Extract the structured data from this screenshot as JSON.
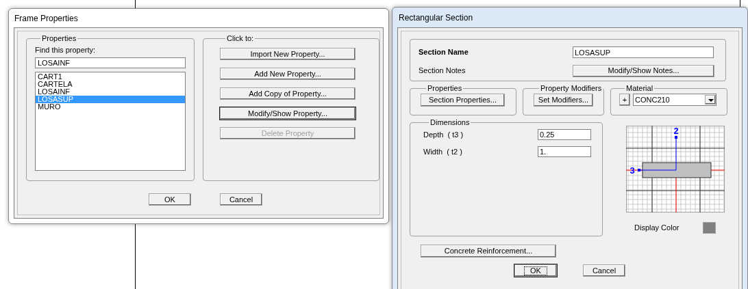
{
  "frame_properties": {
    "title": "Frame Properties",
    "properties_group": {
      "label": "Properties",
      "find_label": "Find this property:",
      "find_value": "LOSAINF",
      "items": [
        {
          "label": "CART1",
          "selected": false
        },
        {
          "label": "CARTELA",
          "selected": false
        },
        {
          "label": "LOSAINF",
          "selected": false
        },
        {
          "label": "LOSASUP",
          "selected": true
        },
        {
          "label": "MURO",
          "selected": false
        }
      ]
    },
    "click_to_group": {
      "label": "Click to:",
      "buttons": [
        {
          "label": "Import New Property...",
          "disabled": false,
          "focused": false
        },
        {
          "label": "Add New Property...",
          "disabled": false,
          "focused": false
        },
        {
          "label": "Add Copy of Property...",
          "disabled": false,
          "focused": false
        },
        {
          "label": "Modify/Show Property...",
          "disabled": false,
          "focused": true
        },
        {
          "label": "Delete Property",
          "disabled": true,
          "focused": false
        }
      ]
    },
    "buttons": [
      {
        "label": "OK",
        "focused": false
      },
      {
        "label": "Cancel",
        "focused": false
      }
    ]
  },
  "rectangular_section": {
    "title": "Rectangular Section",
    "section_name_label": "Section Name",
    "section_name_value": "LOSASUP",
    "section_notes_label": "Section Notes",
    "notes_button": "Modify/Show Notes...",
    "properties": {
      "label": "Properties",
      "button": "Section Properties..."
    },
    "property_modifiers": {
      "label": "Property Modifiers",
      "button": "Set Modifiers..."
    },
    "material": {
      "label": "Material",
      "add_button": "+",
      "value": "CONC210"
    },
    "dimensions": {
      "label": "Dimensions",
      "fields": [
        {
          "label": "Depth  ( t3 )",
          "value": "0.25"
        },
        {
          "label": "Width  ( t2 )",
          "value": "1."
        }
      ]
    },
    "diagram": {
      "axis_labels": [
        "2",
        "3"
      ]
    },
    "display_color": {
      "label": "Display Color",
      "color": "#808080"
    },
    "reinforcement_button": "Concrete Reinforcement...",
    "buttons": [
      {
        "label": "OK",
        "focused": true
      },
      {
        "label": "Cancel",
        "focused": false
      }
    ]
  }
}
